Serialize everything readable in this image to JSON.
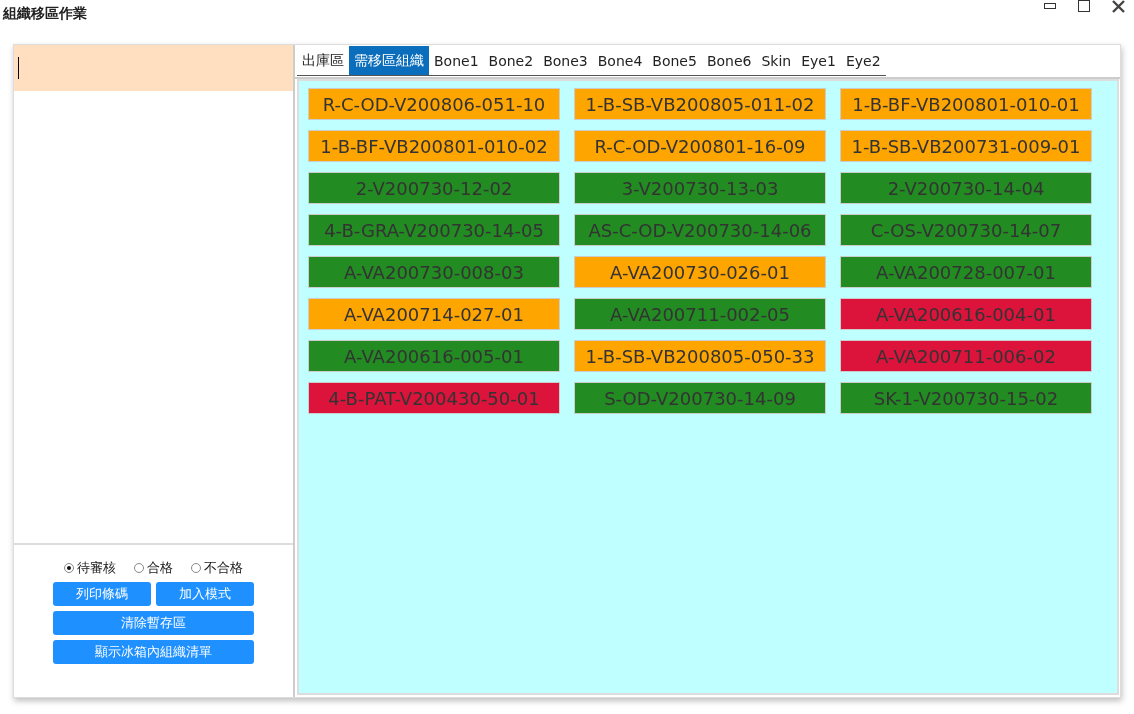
{
  "window": {
    "title": "組織移區作業"
  },
  "status_options": [
    {
      "label": "待審核",
      "selected": true
    },
    {
      "label": "合格",
      "selected": false
    },
    {
      "label": "不合格",
      "selected": false
    }
  ],
  "buttons": [
    {
      "label": "列印條碼",
      "wide": false
    },
    {
      "label": "加入模式",
      "wide": false
    },
    {
      "label": "清除暫存區",
      "wide": true
    },
    {
      "label": "顯示冰箱內組織清單",
      "wide": true
    }
  ],
  "tabs": [
    {
      "label": "出庫區",
      "selected": false
    },
    {
      "label": "需移區組織",
      "selected": true
    },
    {
      "label": "Bone1",
      "selected": false
    },
    {
      "label": "Bone2",
      "selected": false
    },
    {
      "label": "Bone3",
      "selected": false
    },
    {
      "label": "Bone4",
      "selected": false
    },
    {
      "label": "Bone5",
      "selected": false
    },
    {
      "label": "Bone6",
      "selected": false
    },
    {
      "label": "Skin",
      "selected": false
    },
    {
      "label": "Eye1",
      "selected": false
    },
    {
      "label": "Eye2",
      "selected": false
    }
  ],
  "tiles": [
    {
      "label": "R-C-OD-V200806-051-10",
      "color": "#ffa500"
    },
    {
      "label": "1-B-SB-VB200805-011-02",
      "color": "#ffa500"
    },
    {
      "label": "1-B-BF-VB200801-010-01",
      "color": "#ffa500"
    },
    {
      "label": "1-B-BF-VB200801-010-02",
      "color": "#ffa500"
    },
    {
      "label": "R-C-OD-V200801-16-09",
      "color": "#ffa500"
    },
    {
      "label": "1-B-SB-VB200731-009-01",
      "color": "#ffa500"
    },
    {
      "label": "2-V200730-12-02",
      "color": "#228b22"
    },
    {
      "label": "3-V200730-13-03",
      "color": "#228b22"
    },
    {
      "label": "2-V200730-14-04",
      "color": "#228b22"
    },
    {
      "label": "4-B-GRA-V200730-14-05",
      "color": "#228b22"
    },
    {
      "label": "AS-C-OD-V200730-14-06",
      "color": "#228b22"
    },
    {
      "label": "C-OS-V200730-14-07",
      "color": "#228b22"
    },
    {
      "label": "A-VA200730-008-03",
      "color": "#228b22"
    },
    {
      "label": "A-VA200730-026-01",
      "color": "#ffa500"
    },
    {
      "label": "A-VA200728-007-01",
      "color": "#228b22"
    },
    {
      "label": "A-VA200714-027-01",
      "color": "#ffa500"
    },
    {
      "label": "A-VA200711-002-05",
      "color": "#228b22"
    },
    {
      "label": "A-VA200616-004-01",
      "color": "#dc143c"
    },
    {
      "label": "A-VA200616-005-01",
      "color": "#228b22"
    },
    {
      "label": "1-B-SB-VB200805-050-33",
      "color": "#ffa500"
    },
    {
      "label": "A-VA200711-006-02",
      "color": "#dc143c"
    },
    {
      "label": "4-B-PAT-V200430-50-01",
      "color": "#dc143c"
    },
    {
      "label": "S-OD-V200730-14-09",
      "color": "#228b22"
    },
    {
      "label": "SK-1-V200730-15-02",
      "color": "#228b22"
    }
  ]
}
